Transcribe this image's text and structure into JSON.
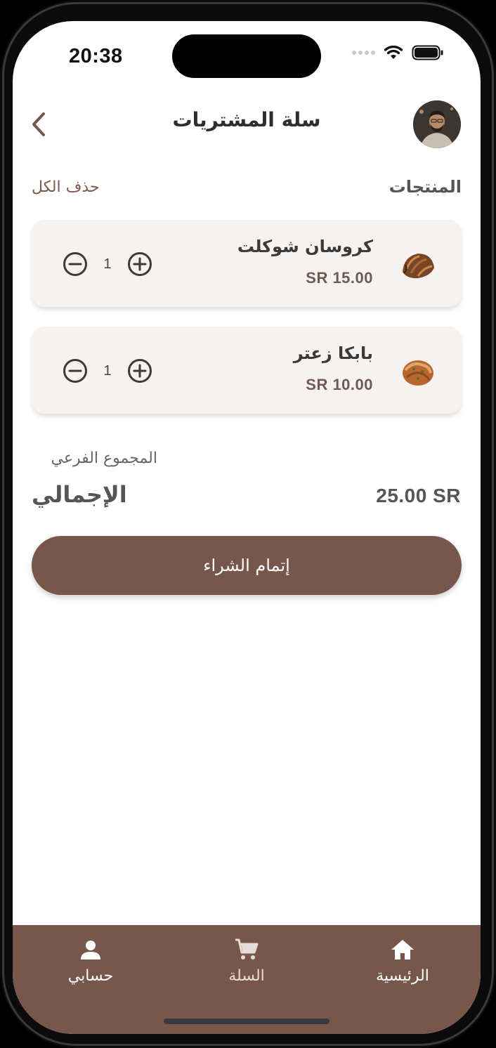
{
  "status_bar": {
    "time": "20:38",
    "icons": [
      "signal-dots-icon",
      "wifi-icon",
      "battery-icon"
    ]
  },
  "header": {
    "title": "سلة المشتريات",
    "back_icon": "chevron-left-icon",
    "avatar": "user-avatar-photo"
  },
  "products": {
    "section_label": "المنتجات",
    "delete_all_label": "حذف الكل",
    "items": [
      {
        "name": "كروسان شوكلت",
        "price": "SR 15.00",
        "quantity": "1",
        "image": "chocolate-croissant"
      },
      {
        "name": "بابكا زعتر",
        "price": "SR 10.00",
        "quantity": "1",
        "image": "zaatar-babka"
      }
    ]
  },
  "summary": {
    "subtotal_label": "المجموع الفرعي",
    "total_label": "الإجمالي",
    "total_value": "25.00 SR"
  },
  "checkout_label": "إتمام الشراء",
  "tabbar": {
    "items": [
      {
        "label": "حسابي",
        "icon": "person-icon"
      },
      {
        "label": "السلة",
        "icon": "cart-icon"
      },
      {
        "label": "الرئيسية",
        "icon": "home-icon"
      }
    ]
  },
  "colors": {
    "brand": "#77574b",
    "card_bg": "#f6f2ef",
    "price_text": "#6e5a52"
  }
}
